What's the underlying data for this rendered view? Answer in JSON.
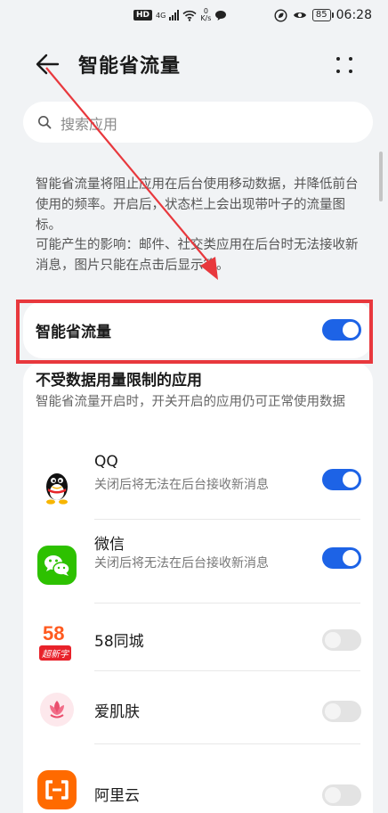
{
  "status_bar": {
    "hd": "HD",
    "network": "4G",
    "speed_value": "0",
    "speed_unit": "K/s",
    "battery": "85",
    "time": "06:28"
  },
  "header": {
    "title": "智能省流量"
  },
  "search": {
    "placeholder": "搜索应用"
  },
  "description": {
    "para1": "智能省流量将阻止应用在后台使用移动数据，并降低前台使用的频率。开启后，状态栏上会出现带叶子的流量图标。",
    "para2": "可能产生的影响：邮件、社交类应用在后台时无法接收新消息，图片只能在点击后显示等。"
  },
  "main_toggle": {
    "label": "智能省流量",
    "state": "on"
  },
  "unrestricted": {
    "title": "不受数据用量限制的应用",
    "desc": "智能省流量开启时，开关开启的应用仍可正常使用数据",
    "apps": [
      {
        "name": "QQ",
        "sub": "关闭后将无法在后台接收新消息",
        "state": "on",
        "icon": "qq-penguin-icon"
      },
      {
        "name": "微信",
        "sub": "关闭后将无法在后台接收新消息",
        "state": "on",
        "icon": "wechat-icon"
      },
      {
        "name": "58同城",
        "sub": "",
        "state": "off",
        "icon": "58-tongcheng-icon",
        "icon_text": "58",
        "icon_subtext": "超新字"
      },
      {
        "name": "爱肌肤",
        "sub": "",
        "state": "off",
        "icon": "aijifu-flower-icon"
      },
      {
        "name": "阿里云",
        "sub": "",
        "state": "off",
        "icon": "aliyun-icon"
      }
    ]
  },
  "colors": {
    "accent": "#1d63e6",
    "highlight_box": "#e8383d",
    "annotation_arrow": "#e8383d"
  }
}
